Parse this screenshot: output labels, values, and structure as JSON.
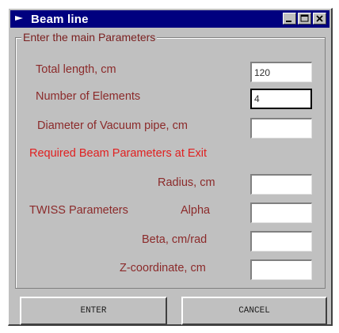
{
  "window": {
    "title": "Beam line",
    "titlebar_color": "#00007f",
    "icons": [
      "app-icon",
      "minimize-icon",
      "maximize-icon",
      "close-icon"
    ]
  },
  "group": {
    "legend": "Enter the main Parameters"
  },
  "fields": {
    "total_length": {
      "label": "Total length, cm",
      "value": "120"
    },
    "num_elements": {
      "label": "Number of Elements",
      "value": "4"
    },
    "diameter": {
      "label": "Diameter of Vacuum pipe, cm",
      "value": ""
    }
  },
  "required_heading": "Required Beam Parameters at Exit",
  "exit_params": {
    "radius": {
      "label": "Radius, cm",
      "value": ""
    },
    "twiss_label": "TWISS Parameters",
    "alpha": {
      "label": "Alpha",
      "value": ""
    },
    "beta": {
      "label": "Beta, cm/rad",
      "value": ""
    },
    "zcoord": {
      "label": "Z-coordinate, cm",
      "value": ""
    }
  },
  "buttons": {
    "enter": "ENTER",
    "cancel": "CANCEL"
  },
  "colors": {
    "label_text": "#8b2a2a",
    "heading_red": "#e02020",
    "face": "#c0c0c0"
  }
}
